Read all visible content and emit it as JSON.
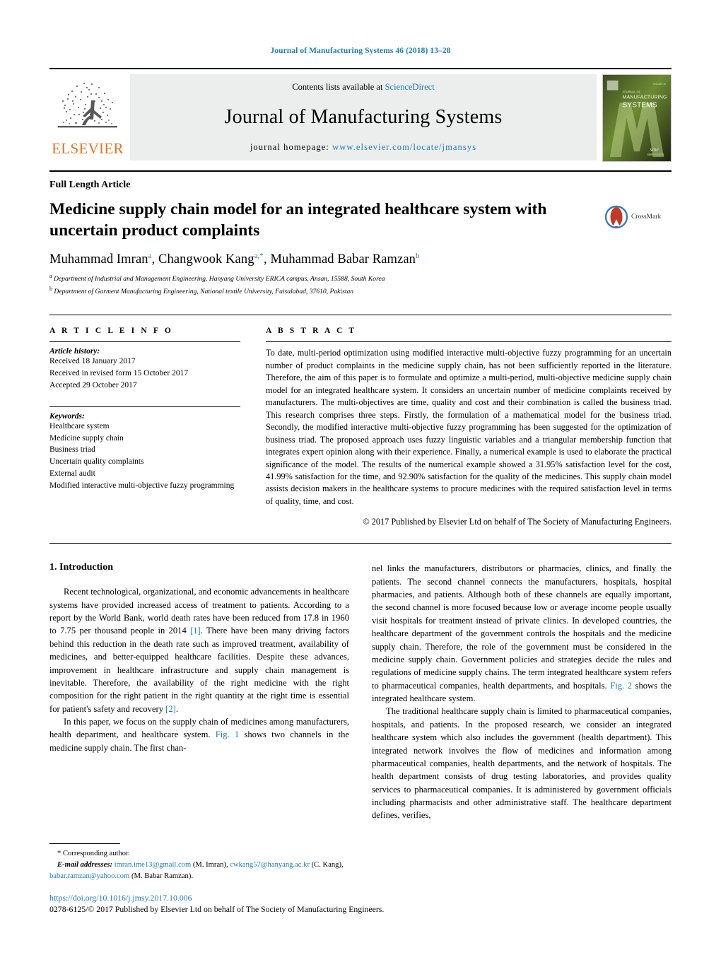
{
  "running_head": "Journal of Manufacturing Systems 46 (2018) 13–28",
  "masthead": {
    "publisher_name": "ELSEVIER",
    "contents_prefix": "Contents lists available at ",
    "contents_link": "ScienceDirect",
    "journal_title": "Journal of Manufacturing Systems",
    "homepage_prefix": "journal homepage: ",
    "homepage_url": "www.elsevier.com/locate/jmansys",
    "cover_line1": "JOURNAL OF",
    "cover_line2": "MANUFACTURING",
    "cover_line3": "SYSTEMS",
    "cover_mark": "sme"
  },
  "article": {
    "type": "Full Length Article",
    "title": "Medicine supply chain model for an integrated healthcare system with uncertain product complaints",
    "crossmark_label": "CrossMark",
    "authors_html": "Muhammad Imran<sup>a</sup>, Changwook Kang<sup>a,*</sup>, Muhammad Babar Ramzan<sup>b</sup>",
    "affiliation_a": "Department of Industrial and Management Engineering, Hanyang University ERICA campus, Ansan, 15588, South Korea",
    "affiliation_b": "Department of Garment Manufacturing Engineering, National textile University, Faisalabad, 37610, Pakistan"
  },
  "info": {
    "heading": "A R T I C L E   I N F O",
    "history_label": "Article history:",
    "history": [
      "Received 18 January 2017",
      "Received in revised form 15 October 2017",
      "Accepted 29 October 2017"
    ],
    "keywords_label": "Keywords:",
    "keywords": [
      "Healthcare system",
      "Medicine supply chain",
      "Business triad",
      "Uncertain quality complaints",
      "External audit",
      "Modified interactive multi-objective fuzzy programming"
    ]
  },
  "abstract": {
    "heading": "A B S T R A C T",
    "text": "To date, multi-period optimization using modified interactive multi-objective fuzzy programming for an uncertain number of product complaints in the medicine supply chain, has not been sufficiently reported in the literature. Therefore, the aim of this paper is to formulate and optimize a multi-period, multi-objective medicine supply chain model for an integrated healthcare system. It considers an uncertain number of medicine complaints received by manufacturers. The multi-objectives are time, quality and cost and their combination is called the business triad. This research comprises three steps. Firstly, the formulation of a mathematical model for the business triad. Secondly, the modified interactive multi-objective fuzzy programming has been suggested for the optimization of business triad. The proposed approach uses fuzzy linguistic variables and a triangular membership function that integrates expert opinion along with their experience. Finally, a numerical example is used to elaborate the practical significance of the model. The results of the numerical example showed a 31.95% satisfaction level for the cost, 41.99% satisfaction for the time, and 92.90% satisfaction for the quality of the medicines. This supply chain model assists decision makers in the healthcare systems to procure medicines with the required satisfaction level in terms of quality, time, and cost.",
    "copyright": "© 2017 Published by Elsevier Ltd on behalf of The Society of Manufacturing Engineers."
  },
  "body": {
    "section_heading": "1.  Introduction",
    "left_para_1_a": "Recent technological, organizational, and economic advancements in healthcare systems have provided increased access of treatment to patients. According to a report by the World Bank, world death rates have been reduced from 17.8 in 1960 to 7.75 per thousand people in 2014 ",
    "left_para_1_ref": "[1]",
    "left_para_1_b": ". There have been many driving factors behind this reduction in the death rate such as improved treatment, availability of medicines, and better-equipped healthcare facilities. Despite these advances, improvement in healthcare infrastructure and supply chain management is inevitable. Therefore, the availability of the right medicine with the right composition for the right patient in the right quantity at the right time is essential for patient's safety and recovery ",
    "left_para_1_ref2": "[2]",
    "left_para_1_c": ".",
    "left_para_2_a": "In this paper, we focus on the supply chain of medicines among manufacturers, health department, and healthcare system. ",
    "left_para_2_ref": "Fig. 1",
    "left_para_2_b": " shows two channels in the medicine supply chain. The first chan-",
    "right_para_1_a": "nel links the manufacturers, distributors or pharmacies, clinics, and finally the patients. The second channel connects the manufacturers, hospitals, hospital pharmacies, and patients. Although both of these channels are equally important, the second channel is more focused because low or average income people usually visit hospitals for treatment instead of private clinics. In developed countries, the healthcare department of the government controls the hospitals and the medicine supply chain. Therefore, the role of the government must be considered in the medicine supply chain. Government policies and strategies decide the rules and regulations of medicine supply chains. The term integrated healthcare system refers to pharmaceutical companies, health departments, and hospitals. ",
    "right_para_1_ref": "Fig. 2",
    "right_para_1_b": " shows the integrated healthcare system.",
    "right_para_2": "The traditional healthcare supply chain is limited to pharmaceutical companies, hospitals, and patients. In the proposed research, we consider an integrated healthcare system which also includes the government (health department). This integrated network involves the flow of medicines and information among pharmaceutical companies, health departments, and the network of hospitals. The health department consists of drug testing laboratories, and provides quality services to pharmaceutical companies. It is administered by government officials including pharmacists and other administrative staff. The healthcare department defines, verifies,"
  },
  "footnotes": {
    "corresponding": "*  Corresponding author.",
    "email_label": "E-mail addresses:",
    "email_1": "imran.ime13@gmail.com",
    "email_1_name": " (M. Imran), ",
    "email_2": "cwkang57@hanyang.ac.kr",
    "email_2_name": " (C. Kang), ",
    "email_3": "babar.ramzan@yahoo.com",
    "email_3_name": "(M. Babar Ramzan).",
    "doi": "https://doi.org/10.1016/j.jmsy.2017.10.006",
    "issn": "0278-6125/© 2017 Published by Elsevier Ltd on behalf of The Society of Manufacturing Engineers."
  },
  "colors": {
    "link": "#1a7db6",
    "elsevier_orange": "#E9711C"
  }
}
